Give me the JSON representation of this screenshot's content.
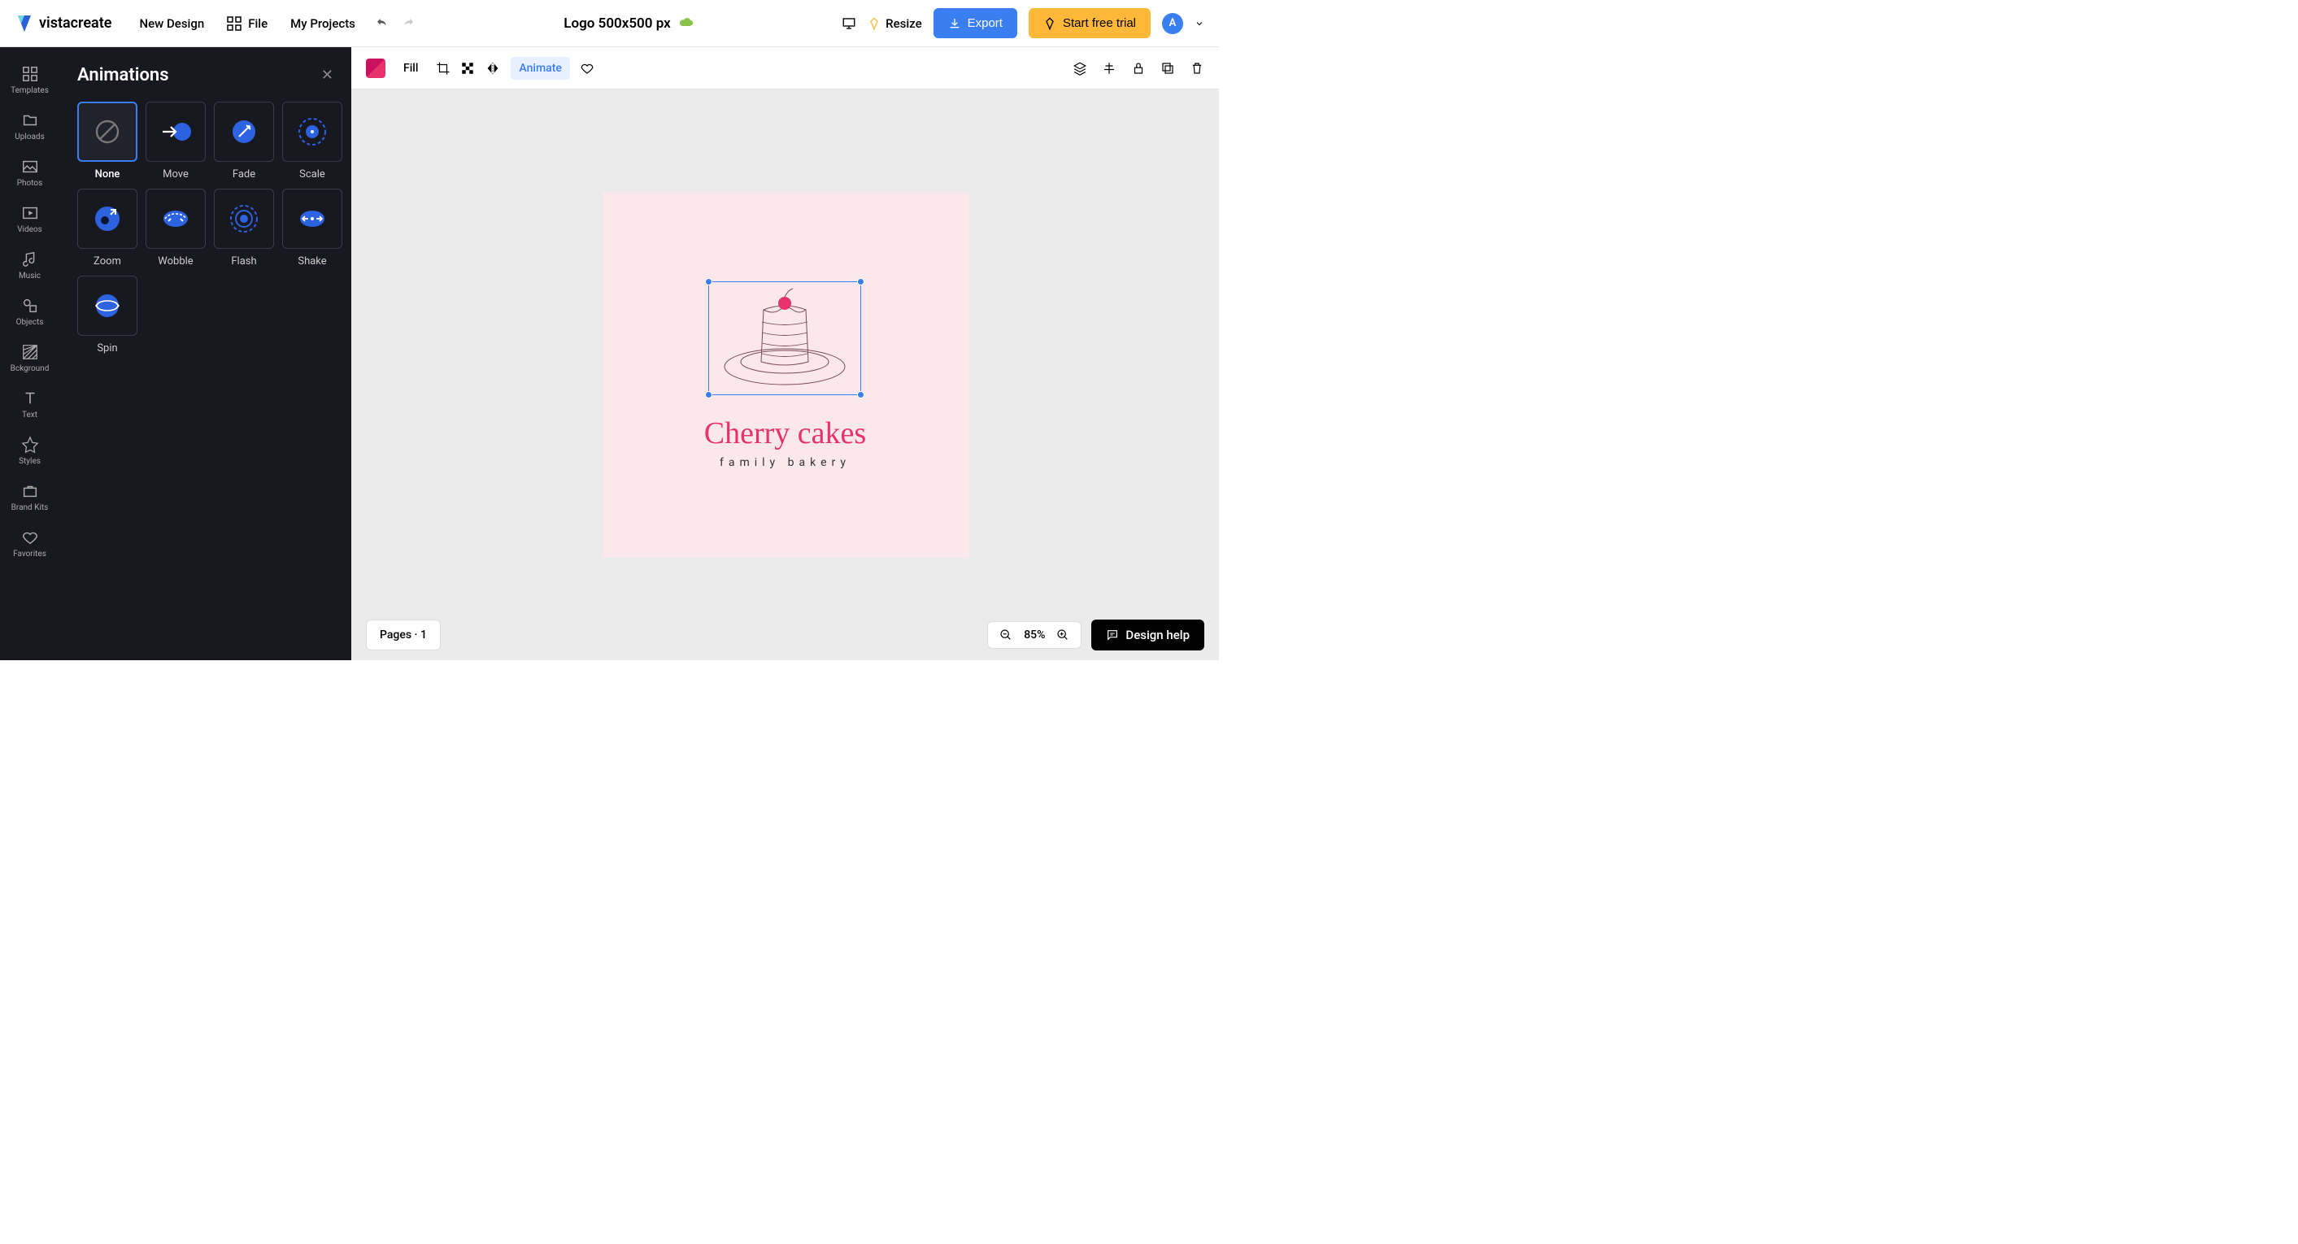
{
  "header": {
    "logo_text": "vistacreate",
    "new_design": "New Design",
    "file": "File",
    "my_projects": "My Projects",
    "doc_title": "Logo 500x500 px",
    "resize": "Resize",
    "export": "Export",
    "start_trial": "Start free trial",
    "avatar_letter": "A"
  },
  "leftrail": {
    "items": [
      {
        "label": "Templates"
      },
      {
        "label": "Uploads"
      },
      {
        "label": "Photos"
      },
      {
        "label": "Videos"
      },
      {
        "label": "Music"
      },
      {
        "label": "Objects"
      },
      {
        "label": "Bckground"
      },
      {
        "label": "Text"
      },
      {
        "label": "Styles"
      },
      {
        "label": "Brand Kits"
      },
      {
        "label": "Favorites"
      }
    ]
  },
  "panel": {
    "title": "Animations",
    "items": [
      {
        "label": "None",
        "selected": true
      },
      {
        "label": "Move"
      },
      {
        "label": "Fade"
      },
      {
        "label": "Scale"
      },
      {
        "label": "Zoom"
      },
      {
        "label": "Wobble"
      },
      {
        "label": "Flash"
      },
      {
        "label": "Shake"
      },
      {
        "label": "Spin"
      }
    ]
  },
  "ctx": {
    "fill": "Fill",
    "animate": "Animate"
  },
  "artboard": {
    "title": "Cherry cakes",
    "subtitle": "family bakery"
  },
  "footer": {
    "pages": "Pages · 1",
    "zoom": "85%",
    "help": "Design help"
  }
}
